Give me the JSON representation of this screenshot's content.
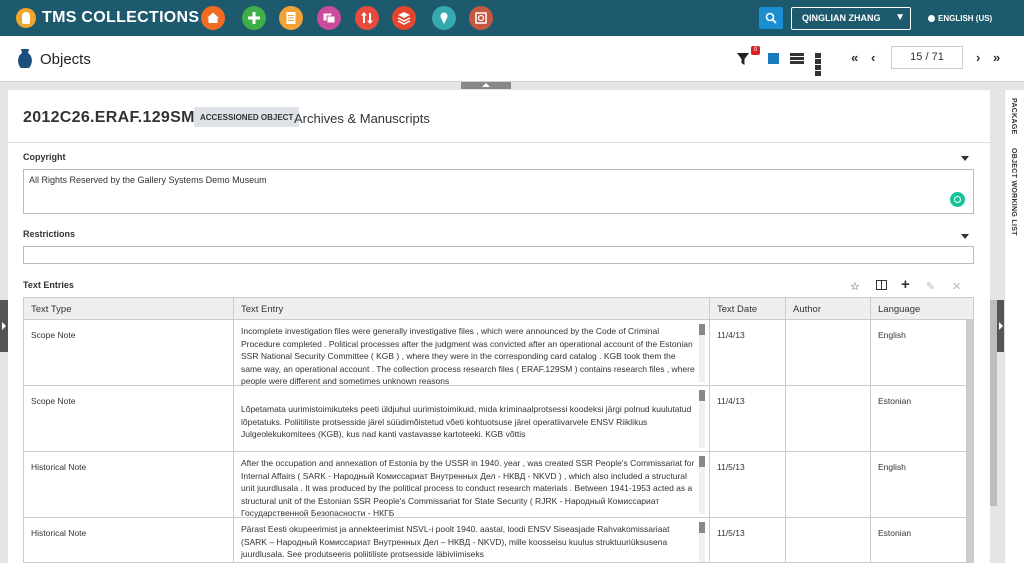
{
  "app": {
    "brand": "TMS COLLECTIONS",
    "toolbar_icons": [
      {
        "name": "home-icon",
        "color": "#f26b23"
      },
      {
        "name": "add-icon",
        "color": "#3fae49"
      },
      {
        "name": "document-icon",
        "color": "#f4a235"
      },
      {
        "name": "media-icon",
        "color": "#c94b9a"
      },
      {
        "name": "sort-icon",
        "color": "#e64b3c"
      },
      {
        "name": "layers-icon",
        "color": "#e4452d"
      },
      {
        "name": "location-icon",
        "color": "#34a9b0"
      },
      {
        "name": "clock-icon",
        "color": "#c4573f"
      }
    ],
    "user": "QINGLIAN ZHANG",
    "language": "ENGLISH (US)"
  },
  "module": {
    "title": "Objects",
    "filter_count": "0",
    "pager": "15 / 71"
  },
  "record": {
    "object_number": "2012C26.ERAF.129SM",
    "badge": "ACCESSIONED OBJECT",
    "department": "Archives & Manuscripts"
  },
  "copyright": {
    "label": "Copyright",
    "value": "All Rights Reserved by the Gallery Systems Demo Museum"
  },
  "restrictions": {
    "label": "Restrictions",
    "value": ""
  },
  "text_entries": {
    "label": "Text Entries",
    "columns": [
      "Text Type",
      "Text Entry",
      "Text Date",
      "Author",
      "Language"
    ],
    "rows": [
      {
        "type": "Scope Note",
        "entry": "Incomplete investigation files were generally investigative files , which were announced by the Code of Criminal Procedure completed . Political processes after the judgment was convicted after an operational account of the Estonian SSR National Security Committee ( KGB ) , where they were in the corresponding card catalog . KGB took them the same way, an operational account . The collection process research files ( ERAF.129SM ) contains research files , where people were different and sometimes unknown reasons",
        "date": "11/4/13",
        "author": "",
        "language": "English"
      },
      {
        "type": "Scope Note",
        "entry": "Lõpetamata uurimistoimikuteks peeti üldjuhul uurimistoimikuid, mida kriminaalprotsessi koodeksi järgi polnud kuulutatud lõpetatuks. Poliitiliste protsesside järel süüdimõistetud võeti kohtuotsuse järel operatiivarvele ENSV Riiklikus Julgeolekukomitees (KGB), kus nad kanti vastavasse kartoteeki. KGB võttis",
        "date": "11/4/13",
        "author": "",
        "language": "Estonian"
      },
      {
        "type": "Historical Note",
        "entry": "After the occupation and annexation of Estonia by the USSR in 1940. year , was created SSR People's Commissariat for Internal Affairs ( SARK - Народный Комиссариат Внутренных Дел - НКВД - NKVD ) , which also included a structural unit juurdlusala . It was produced by the political process to conduct research materials . Between 1941-1953 acted as a structural unit of the Estonian SSR People's Commissariat for State Security ( RJRK - Народный Комиссариат Государственной Безопасности - НКГБ",
        "date": "11/5/13",
        "author": "",
        "language": "English"
      },
      {
        "type": "Historical Note",
        "entry": "Pärast Eesti okupeerimist ja annekteerimist NSVL-i poolt 1940. aastal, loodi ENSV Siseasjade Rahvakomissariaat (SARK – Народный Комиссариат Внутренных Дел – НКВД - NKVD), mille koosseisu kuulus struktuuriüksusena juurdlusala. See produtseeris poliitiliste protsesside läbiviimiseks",
        "date": "11/5/13",
        "author": "",
        "language": "Estonian"
      }
    ]
  },
  "side_tabs": {
    "package": "PACKAGE",
    "working_list": "OBJECT WORKING LIST"
  }
}
